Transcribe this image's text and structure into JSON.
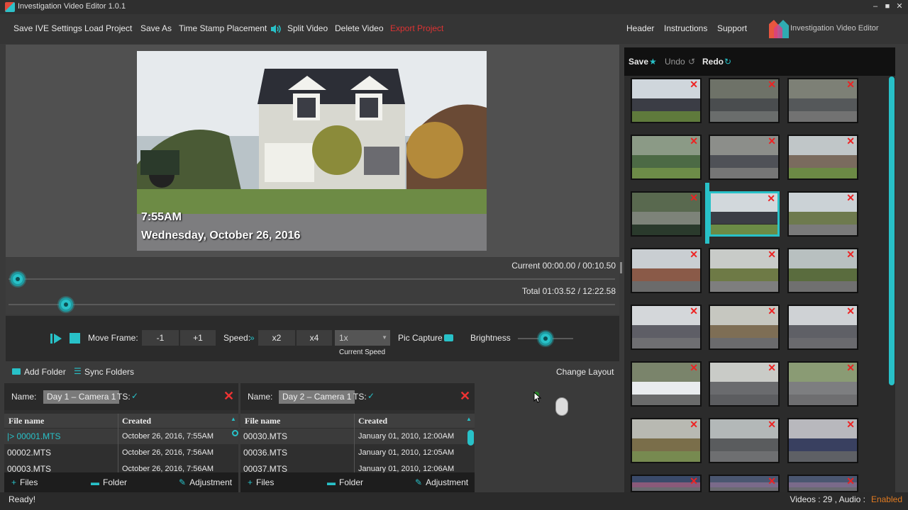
{
  "window": {
    "title": "Investigation Video Editor 1.0.1",
    "minimize": "‒",
    "maximize": "■",
    "close": "✕"
  },
  "menu": {
    "save_settings": "Save IVE Settings",
    "load_project": "Load Project",
    "save_as": "Save As",
    "timestamp": "Time Stamp Placement",
    "split_video": "Split Video",
    "delete_video": "Delete Video",
    "export_project": "Export Project",
    "header": "Header",
    "instructions": "Instructions",
    "support": "Support",
    "brand": "Investigation Video Editor"
  },
  "video": {
    "time": "7:55AM",
    "date": "Wednesday, October 26, 2016"
  },
  "timeline": {
    "current": "Current 00:00.00 / 00:10.50",
    "total": "Total 01:03.52 / 12:22.58",
    "current_progress": 0.015,
    "total_progress": 0.095
  },
  "controls": {
    "move_frame": "Move Frame:",
    "minus1": "-1",
    "plus1": "+1",
    "speed": "Speed:",
    "x2": "x2",
    "x4": "x4",
    "speed_value": "1x",
    "current_speed": "Current Speed",
    "pic_capture": "Pic Capture",
    "brightness": "Brightness",
    "brightness_level": 0.5
  },
  "folders": {
    "add_folder": "Add Folder",
    "sync_folders": "Sync Folders",
    "change_layout": "Change Layout"
  },
  "panels": [
    {
      "name_label": "Name:",
      "name": "Day 1 – Camera 1",
      "ts_label": "TS:",
      "col_file": "File name",
      "col_created": "Created",
      "rows": [
        {
          "file": "|> 00001.MTS",
          "created": "October 26, 2016, 7:55AM"
        },
        {
          "file": "00002.MTS",
          "created": "October 26, 2016, 7:56AM"
        },
        {
          "file": "00003.MTS",
          "created": "October 26, 2016, 7:56AM"
        }
      ],
      "files_btn": "Files",
      "folder_btn": "Folder",
      "adjust_btn": "Adjustment"
    },
    {
      "name_label": "Name:",
      "name": "Day 2 – Camera 1",
      "ts_label": "TS:",
      "col_file": "File name",
      "col_created": "Created",
      "rows": [
        {
          "file": "00030.MTS",
          "created": "January 01, 2010, 12:00AM"
        },
        {
          "file": "00036.MTS",
          "created": "January 01, 2010, 12:05AM"
        },
        {
          "file": "00037.MTS",
          "created": "January 01, 2010, 12:06AM"
        }
      ],
      "files_btn": "Files",
      "folder_btn": "Folder",
      "adjust_btn": "Adjustment"
    }
  ],
  "right_toolbar": {
    "save": "Save",
    "undo": "Undo",
    "redo": "Redo"
  },
  "thumbnails": [
    {
      "sky": "#cfd6dc",
      "mid": "#3b3d45",
      "gnd": "#5f7a3c"
    },
    {
      "sky": "#6e7268",
      "mid": "#4a4d4f",
      "gnd": "#6a6d6c"
    },
    {
      "sky": "#7d8076",
      "mid": "#55585a",
      "gnd": "#727272"
    },
    {
      "sky": "#8b9a86",
      "mid": "#4c6a45",
      "gnd": "#6d8c48"
    },
    {
      "sky": "#8c8e8a",
      "mid": "#4f5157",
      "gnd": "#767676"
    },
    {
      "sky": "#c0c6c8",
      "mid": "#7a6b5e",
      "gnd": "#6c8a45"
    },
    {
      "sky": "#59694f",
      "mid": "#7d8379",
      "gnd": "#2a3a2c"
    },
    {
      "sky": "#d2d8dc",
      "mid": "#3b3d45",
      "gnd": "#6b8b46"
    },
    {
      "sky": "#cbd2d6",
      "mid": "#6e7a4e",
      "gnd": "#7a7a7a"
    },
    {
      "sky": "#c9ced2",
      "mid": "#8a5a48",
      "gnd": "#6b6b6b"
    },
    {
      "sky": "#c8cbc8",
      "mid": "#6e7a46",
      "gnd": "#7e7e7e"
    },
    {
      "sky": "#b8c0c0",
      "mid": "#5a6c3e",
      "gnd": "#707070"
    },
    {
      "sky": "#d4d7da",
      "mid": "#5e5e66",
      "gnd": "#6f6f72"
    },
    {
      "sky": "#c6c7c0",
      "mid": "#7e6e55",
      "gnd": "#6b6b6d"
    },
    {
      "sky": "#cfd2d5",
      "mid": "#5f6066",
      "gnd": "#6a6a6e"
    },
    {
      "sky": "#7a846b",
      "mid": "#e9ecee",
      "gnd": "#6a6b6b"
    },
    {
      "sky": "#c9cbc7",
      "mid": "#6a6b6e",
      "gnd": "#5c5d60"
    },
    {
      "sky": "#8a9b74",
      "mid": "#7d7e80",
      "gnd": "#6e6e70"
    },
    {
      "sky": "#b8b9b2",
      "mid": "#7a6e4a",
      "gnd": "#778a50"
    },
    {
      "sky": "#b3b8b8",
      "mid": "#5a5c5e",
      "gnd": "#6e6f71"
    },
    {
      "sky": "#b8b8bd",
      "mid": "#394060",
      "gnd": "#5e6065"
    },
    {
      "sky": "#3a4a6a",
      "mid": "#8a5a7a",
      "gnd": "#6a6a70"
    },
    {
      "sky": "#4a5670",
      "mid": "#7a6a8a",
      "gnd": "#6a6a70"
    },
    {
      "sky": "#4a5670",
      "mid": "#7a6a8a",
      "gnd": "#6a6a70"
    }
  ],
  "status": {
    "ready": "Ready!",
    "videos": "Videos : 29 , Audio :",
    "audio_state": "Enabled"
  },
  "colors": {
    "accent": "#28c1c8",
    "close_red": "#e22222",
    "audio_enabled": "#e07a20"
  }
}
